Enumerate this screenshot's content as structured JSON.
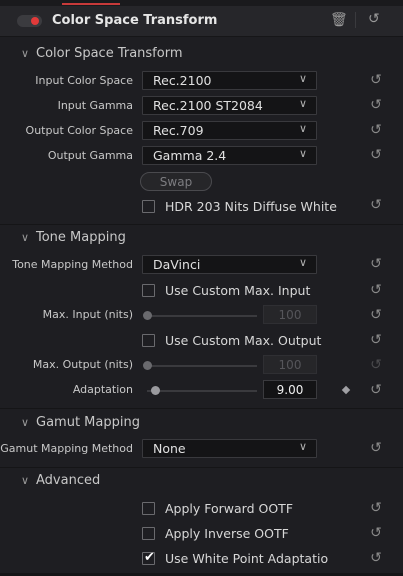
{
  "header": {
    "title": "Color Space Transform"
  },
  "sections": {
    "cst": "Color Space Transform",
    "tone": "Tone Mapping",
    "gamut": "Gamut Mapping",
    "advanced": "Advanced"
  },
  "cst": {
    "input_color_space_label": "Input Color Space",
    "input_color_space_value": "Rec.2100",
    "input_gamma_label": "Input Gamma",
    "input_gamma_value": "Rec.2100 ST2084",
    "output_color_space_label": "Output Color Space",
    "output_color_space_value": "Rec.709",
    "output_gamma_label": "Output Gamma",
    "output_gamma_value": "Gamma 2.4",
    "swap_label": "Swap",
    "hdr_label": "HDR 203 Nits Diffuse White",
    "hdr_checked": false
  },
  "tone": {
    "method_label": "Tone Mapping Method",
    "method_value": "DaVinci",
    "custom_input_label": "Use Custom Max. Input",
    "custom_input_checked": false,
    "max_input_label": "Max. Input (nits)",
    "max_input_value": "100",
    "custom_output_label": "Use Custom Max. Output",
    "custom_output_checked": false,
    "max_output_label": "Max. Output (nits)",
    "max_output_value": "100",
    "adaptation_label": "Adaptation",
    "adaptation_value": "9.00"
  },
  "gamut": {
    "method_label": "Gamut Mapping Method",
    "method_value": "None"
  },
  "advanced": {
    "forward_ootf_label": "Apply Forward OOTF",
    "forward_ootf_checked": false,
    "inverse_ootf_label": "Apply Inverse OOTF",
    "inverse_ootf_checked": false,
    "white_point_label": "Use White Point Adaptatio",
    "white_point_checked": true
  },
  "colors": {
    "toggle_on": "#e23a3a",
    "panel_bg": "#1e1e22",
    "field_bg": "#141416"
  },
  "icons": {
    "delete": "trash-icon",
    "reset": "reset-icon",
    "collapse": "chevron-down-icon",
    "keyframe": "diamond-icon"
  }
}
